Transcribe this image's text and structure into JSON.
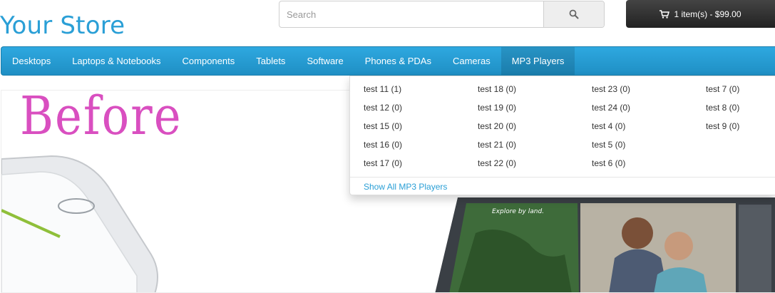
{
  "store": {
    "logo": "Your Store"
  },
  "search": {
    "placeholder": "Search",
    "button_icon": "search-icon"
  },
  "cart": {
    "label": "1 item(s) - $99.00",
    "icon": "cart-icon"
  },
  "nav": {
    "items": [
      "Desktops",
      "Laptops & Notebooks",
      "Components",
      "Tablets",
      "Software",
      "Phones & PDAs",
      "Cameras",
      "MP3 Players"
    ],
    "active": "MP3 Players"
  },
  "dropdown": {
    "columns": [
      [
        "test 11 (1)",
        "test 12 (0)",
        "test 15 (0)",
        "test 16 (0)",
        "test 17 (0)"
      ],
      [
        "test 18 (0)",
        "test 19 (0)",
        "test 20 (0)",
        "test 21 (0)",
        "test 22 (0)"
      ],
      [
        "test 23 (0)",
        "test 24 (0)",
        "test 4 (0)",
        "test 5 (0)",
        "test 6 (0)"
      ],
      [
        "test 7 (0)",
        "test 8 (0)",
        "test 9 (0)"
      ]
    ],
    "show_all": "Show All MP3 Players"
  },
  "slider": {
    "overlay_text": "Before",
    "tablet_caption": "Explore by land."
  },
  "colors": {
    "brand": "#2a9fd6",
    "navbar": "#229ac8",
    "overlay_pink": "#d94fc0",
    "cart_button": "#303030"
  }
}
